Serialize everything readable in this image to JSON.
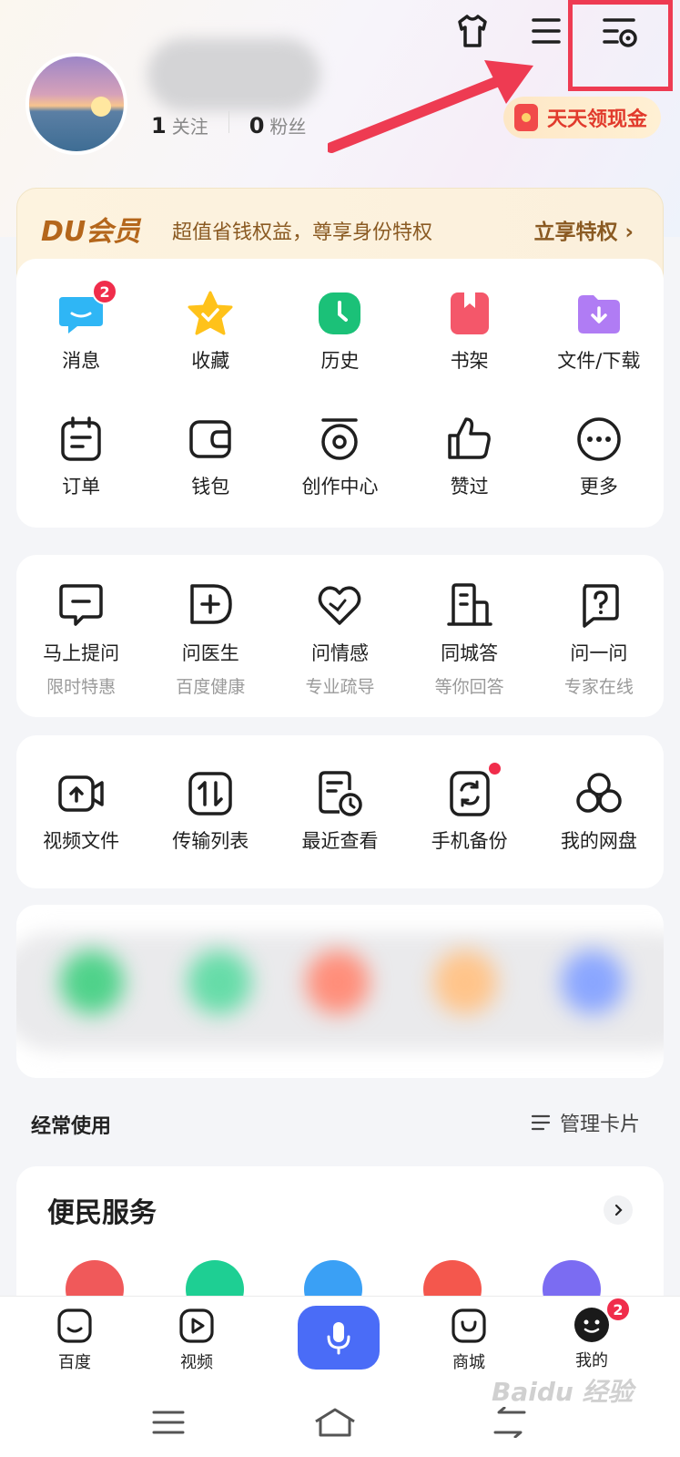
{
  "profile": {
    "follow_count": "1",
    "follow_label": "关注",
    "fans_count": "0",
    "fans_label": "粉丝"
  },
  "cash_button": {
    "label": "天天领现金"
  },
  "vip": {
    "logo": "DU会员",
    "desc": "超值省钱权益，尊享身份特权",
    "link": "立享特权 ›"
  },
  "main_grid": [
    {
      "label": "消息",
      "icon": "message-icon",
      "badge": "2"
    },
    {
      "label": "收藏",
      "icon": "star-icon"
    },
    {
      "label": "历史",
      "icon": "clock-icon"
    },
    {
      "label": "书架",
      "icon": "bookshelf-icon"
    },
    {
      "label": "文件/下载",
      "icon": "folder-download-icon"
    },
    {
      "label": "订单",
      "icon": "order-icon"
    },
    {
      "label": "钱包",
      "icon": "wallet-icon"
    },
    {
      "label": "创作中心",
      "icon": "creation-icon"
    },
    {
      "label": "赞过",
      "icon": "thumbs-up-icon"
    },
    {
      "label": "更多",
      "icon": "more-icon"
    }
  ],
  "ask_grid": [
    {
      "label": "马上提问",
      "sub": "限时特惠"
    },
    {
      "label": "问医生",
      "sub": "百度健康"
    },
    {
      "label": "问情感",
      "sub": "专业疏导"
    },
    {
      "label": "同城答",
      "sub": "等你回答"
    },
    {
      "label": "问一问",
      "sub": "专家在线"
    }
  ],
  "disk_grid": [
    {
      "label": "视频文件"
    },
    {
      "label": "传输列表"
    },
    {
      "label": "最近查看"
    },
    {
      "label": "手机备份"
    },
    {
      "label": "我的网盘"
    }
  ],
  "frequent": {
    "title": "经常使用",
    "manage": "管理卡片"
  },
  "services": {
    "title": "便民服务"
  },
  "tabbar": {
    "home": "百度",
    "video": "视频",
    "mall": "商城",
    "mine": "我的",
    "mine_badge": "2"
  },
  "watermark": "Baidu 经验",
  "colors": {
    "accent": "#4a6cf7",
    "badge": "#f02d4b",
    "highlight": "#ee3b52"
  }
}
